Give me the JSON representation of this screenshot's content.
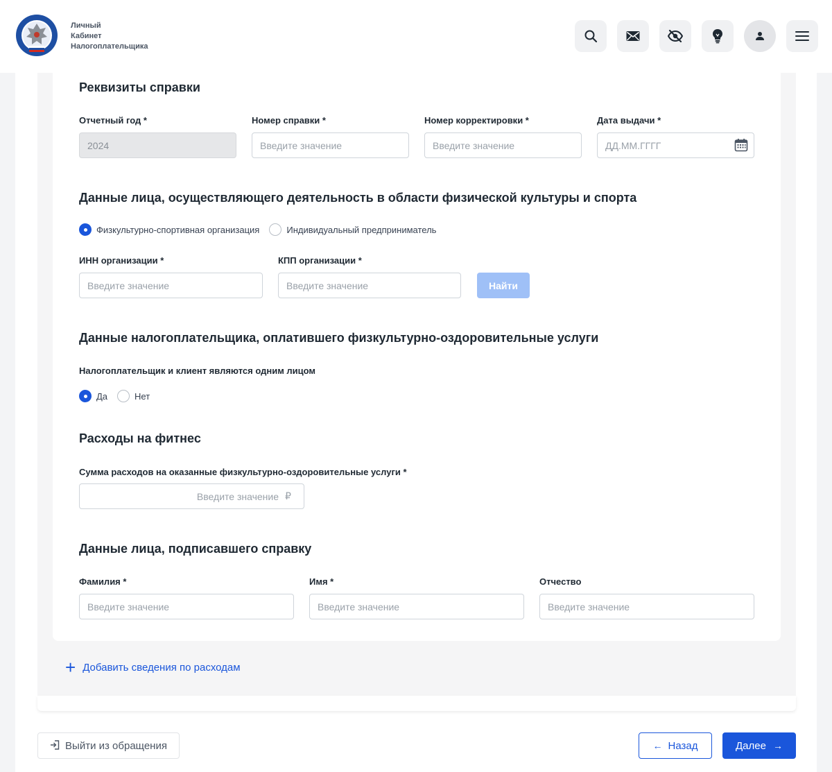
{
  "header": {
    "logo_line1": "Личный",
    "logo_line2": "Кабинет",
    "logo_line3": "Налогоплательщика",
    "icons": [
      "search-icon",
      "mail-icon",
      "eye-off-icon",
      "lightbulb-icon",
      "user-icon",
      "menu-icon"
    ]
  },
  "colors": {
    "accent": "#1a56db",
    "accent_disabled": "#9fc0f7"
  },
  "sections": {
    "requisites": {
      "title": "Реквизиты справки",
      "year_label": "Отчетный год *",
      "year_value": "2024",
      "number_label": "Номер справки *",
      "number_placeholder": "Введите значение",
      "correction_label": "Номер корректировки *",
      "correction_placeholder": "Введите значение",
      "date_label": "Дата выдачи *",
      "date_placeholder": "ДД.ММ.ГГГГ"
    },
    "organization": {
      "title": "Данные лица, осуществляющего деятельность в области физической культуры и спорта",
      "radio_org": "Физкультурно-спортивная организация",
      "radio_ip": "Индивидуальный предприниматель",
      "inn_label": "ИНН организации *",
      "inn_placeholder": "Введите значение",
      "kpp_label": "КПП организации *",
      "kpp_placeholder": "Введите значение",
      "find_button": "Найти"
    },
    "taxpayer": {
      "title": "Данные налогоплательщика, оплатившего физкультурно-оздоровительные услуги",
      "same_person_label": "Налогоплательщик и клиент являются одним лицом",
      "yes": "Да",
      "no": "Нет"
    },
    "expenses": {
      "title": "Расходы на фитнес",
      "amount_label": "Сумма расходов на оказанные физкультурно-оздоровительные услуги *",
      "amount_placeholder": "Введите значение",
      "currency": "₽"
    },
    "signer": {
      "title": "Данные лица, подписавшего справку",
      "surname_label": "Фамилия *",
      "surname_placeholder": "Введите значение",
      "name_label": "Имя *",
      "name_placeholder": "Введите значение",
      "patronymic_label": "Отчество",
      "patronymic_placeholder": "Введите значение"
    }
  },
  "add_expense_link": "Добавить сведения по расходам",
  "footer": {
    "exit": "Выйти из обращения",
    "back": "Назад",
    "next": "Далее"
  }
}
